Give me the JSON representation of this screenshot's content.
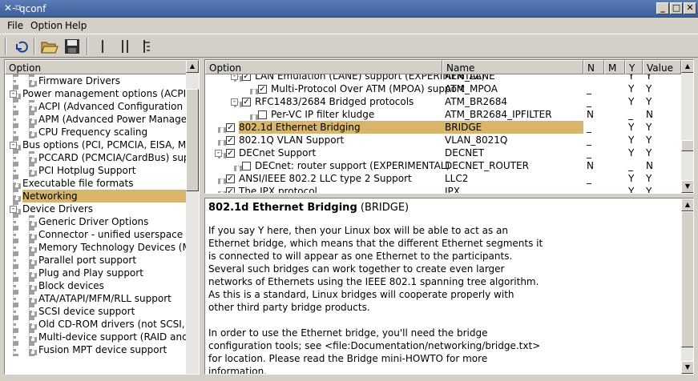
{
  "window": {
    "title": "qconf",
    "minimize": "_",
    "maximize": "□",
    "close": "✕"
  },
  "menu": {
    "file": "File",
    "option": "Option",
    "help": "Help"
  },
  "left_panel": {
    "header": "Option",
    "items": [
      {
        "label": "Firmware Drivers",
        "indent": 2,
        "expander": ""
      },
      {
        "label": "Power management options (ACPI, APM)",
        "indent": 1,
        "expander": "-"
      },
      {
        "label": "ACPI (Advanced Configuration and Power Interface) Support",
        "indent": 2,
        "expander": ""
      },
      {
        "label": "APM (Advanced Power Management) BIOS Support",
        "indent": 2,
        "expander": ""
      },
      {
        "label": "CPU Frequency scaling",
        "indent": 2,
        "expander": ""
      },
      {
        "label": "Bus options (PCI, PCMCIA, EISA, MCA, ISA)",
        "indent": 1,
        "expander": "-"
      },
      {
        "label": "PCCARD (PCMCIA/CardBus) support",
        "indent": 2,
        "expander": ""
      },
      {
        "label": "PCI Hotplug Support",
        "indent": 2,
        "expander": ""
      },
      {
        "label": "Executable file formats",
        "indent": 1,
        "expander": ""
      },
      {
        "label": "Networking",
        "indent": 1,
        "expander": "",
        "selected": true
      },
      {
        "label": "Device Drivers",
        "indent": 1,
        "expander": "-"
      },
      {
        "label": "Generic Driver Options",
        "indent": 2,
        "expander": ""
      },
      {
        "label": "Connector - unified userspace <-> kernelspace linker",
        "indent": 2,
        "expander": ""
      },
      {
        "label": "Memory Technology Devices (MTD)",
        "indent": 2,
        "expander": ""
      },
      {
        "label": "Parallel port support",
        "indent": 2,
        "expander": ""
      },
      {
        "label": "Plug and Play support",
        "indent": 2,
        "expander": ""
      },
      {
        "label": "Block devices",
        "indent": 2,
        "expander": ""
      },
      {
        "label": "ATA/ATAPI/MFM/RLL support",
        "indent": 2,
        "expander": ""
      },
      {
        "label": "SCSI device support",
        "indent": 2,
        "expander": ""
      },
      {
        "label": "Old CD-ROM drivers (not SCSI, not IDE)",
        "indent": 2,
        "expander": ""
      },
      {
        "label": "Multi-device support (RAID and LVM)",
        "indent": 2,
        "expander": ""
      },
      {
        "label": "Fusion MPT device support",
        "indent": 2,
        "expander": ""
      }
    ]
  },
  "right_panel": {
    "headers": {
      "option": "Option",
      "name": "Name",
      "n": "N",
      "m": "M",
      "y": "Y",
      "value": "Value"
    },
    "rows": [
      {
        "label": "LAN Emulation (LANE) support (EXPERIMENTAL)",
        "name": "ATM_LANE",
        "n": "",
        "m": "",
        "y": "Y",
        "value": "Y",
        "level": 2,
        "expander": "-",
        "checked": true
      },
      {
        "label": "Multi-Protocol Over ATM (MPOA) support",
        "name": "ATM_MPOA",
        "n": "_",
        "m": "",
        "y": "Y",
        "value": "Y",
        "level": 3,
        "expander": "",
        "checked": true
      },
      {
        "label": "RFC1483/2684 Bridged protocols",
        "name": "ATM_BR2684",
        "n": "_",
        "m": "",
        "y": "Y",
        "value": "Y",
        "level": 2,
        "expander": "-",
        "checked": true
      },
      {
        "label": "Per-VC IP filter kludge",
        "name": "ATM_BR2684_IPFILTER",
        "n": "N",
        "m": "",
        "y": "_",
        "value": "N",
        "level": 3,
        "expander": "",
        "checked": false
      },
      {
        "label": "802.1d Ethernet Bridging",
        "name": "BRIDGE",
        "n": "_",
        "m": "",
        "y": "Y",
        "value": "Y",
        "level": 1,
        "expander": "",
        "checked": true,
        "selected": true
      },
      {
        "label": "802.1Q VLAN Support",
        "name": "VLAN_8021Q",
        "n": "_",
        "m": "",
        "y": "Y",
        "value": "Y",
        "level": 1,
        "expander": "",
        "checked": true
      },
      {
        "label": "DECnet Support",
        "name": "DECNET",
        "n": "_",
        "m": "",
        "y": "Y",
        "value": "Y",
        "level": 1,
        "expander": "-",
        "checked": true
      },
      {
        "label": "DECnet: router support (EXPERIMENTAL)",
        "name": "DECNET_ROUTER",
        "n": "N",
        "m": "",
        "y": "_",
        "value": "N",
        "level": 2,
        "expander": "",
        "checked": false
      },
      {
        "label": "ANSI/IEEE 802.2 LLC type 2 Support",
        "name": "LLC2",
        "n": "_",
        "m": "",
        "y": "Y",
        "value": "Y",
        "level": 1,
        "expander": "",
        "checked": true
      },
      {
        "label": "The IPX protocol",
        "name": "IPX",
        "n": "",
        "m": "",
        "y": "Y",
        "value": "Y",
        "level": 1,
        "expander": "",
        "checked": true
      }
    ]
  },
  "help": {
    "title": "802.1d Ethernet Bridging",
    "symbol": "(BRIDGE)",
    "paragraphs": [
      "If you say Y here, then your Linux box will be able to act as an\nEthernet bridge, which means that the different Ethernet segments it\nis connected to will appear as one Ethernet to the participants.\nSeveral such bridges can work together to create even larger\nnetworks of Ethernets using the IEEE 802.1 spanning tree algorithm.\nAs this is a standard, Linux bridges will cooperate properly with\nother third party bridge products.",
      "In order to use the Ethernet bridge, you'll need the bridge\nconfiguration tools; see <file:Documentation/networking/bridge.txt>\nfor location. Please read the Bridge mini-HOWTO for more\ninformation."
    ]
  },
  "colors": {
    "selected": "#d8b568",
    "titlebar": "#4a6ea9"
  },
  "icons": [
    "back-icon",
    "open-folder-icon",
    "save-icon",
    "single-view-icon",
    "split-view-icon",
    "full-view-icon"
  ]
}
